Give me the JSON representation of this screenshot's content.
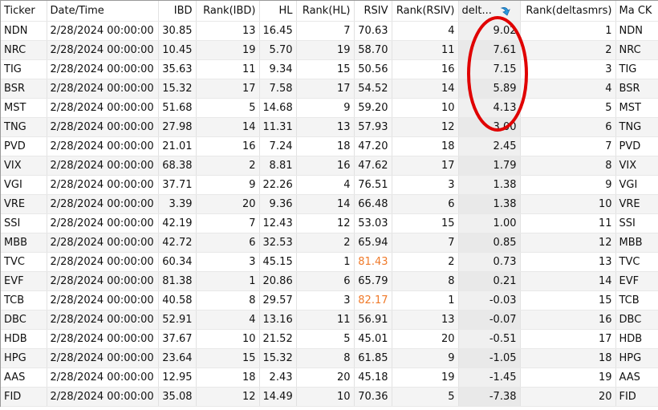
{
  "columns": [
    "Ticker",
    "Date/Time",
    "IBD",
    "Rank(IBD)",
    "HL",
    "Rank(HL)",
    "RSIV",
    "Rank(RSIV)",
    "delt...",
    "Rank(deltasmrs)",
    "Ma CK"
  ],
  "sort": {
    "column": "delt...",
    "direction": "descending",
    "icon": "sort-descending-arrow-icon"
  },
  "highlight_color": "#f07a2a",
  "annotation_color": "#e00000",
  "rows": [
    [
      "NDN",
      "2/28/2024 00:00:00",
      "30.85",
      "13",
      "16.45",
      "7",
      "70.63",
      "4",
      "9.02",
      "1",
      "NDN"
    ],
    [
      "NRC",
      "2/28/2024 00:00:00",
      "10.45",
      "19",
      "5.70",
      "19",
      "58.70",
      "11",
      "7.61",
      "2",
      "NRC"
    ],
    [
      "TIG",
      "2/28/2024 00:00:00",
      "35.63",
      "11",
      "9.34",
      "15",
      "50.56",
      "16",
      "7.15",
      "3",
      "TIG"
    ],
    [
      "BSR",
      "2/28/2024 00:00:00",
      "15.32",
      "17",
      "7.58",
      "17",
      "54.52",
      "14",
      "5.89",
      "4",
      "BSR"
    ],
    [
      "MST",
      "2/28/2024 00:00:00",
      "51.68",
      "5",
      "14.68",
      "9",
      "59.20",
      "10",
      "4.13",
      "5",
      "MST"
    ],
    [
      "TNG",
      "2/28/2024 00:00:00",
      "27.98",
      "14",
      "11.31",
      "13",
      "57.93",
      "12",
      "3.00",
      "6",
      "TNG"
    ],
    [
      "PVD",
      "2/28/2024 00:00:00",
      "21.01",
      "16",
      "7.24",
      "18",
      "47.20",
      "18",
      "2.45",
      "7",
      "PVD"
    ],
    [
      "VIX",
      "2/28/2024 00:00:00",
      "68.38",
      "2",
      "8.81",
      "16",
      "47.62",
      "17",
      "1.79",
      "8",
      "VIX"
    ],
    [
      "VGI",
      "2/28/2024 00:00:00",
      "37.71",
      "9",
      "22.26",
      "4",
      "76.51",
      "3",
      "1.38",
      "9",
      "VGI"
    ],
    [
      "VRE",
      "2/28/2024 00:00:00",
      "3.39",
      "20",
      "9.36",
      "14",
      "66.48",
      "6",
      "1.38",
      "10",
      "VRE"
    ],
    [
      "SSI",
      "2/28/2024 00:00:00",
      "42.19",
      "7",
      "12.43",
      "12",
      "53.03",
      "15",
      "1.00",
      "11",
      "SSI"
    ],
    [
      "MBB",
      "2/28/2024 00:00:00",
      "42.72",
      "6",
      "32.53",
      "2",
      "65.94",
      "7",
      "0.85",
      "12",
      "MBB"
    ],
    [
      "TVC",
      "2/28/2024 00:00:00",
      "60.34",
      "3",
      "45.15",
      "1",
      "81.43",
      "2",
      "0.73",
      "13",
      "TVC"
    ],
    [
      "EVF",
      "2/28/2024 00:00:00",
      "81.38",
      "1",
      "20.86",
      "6",
      "65.79",
      "8",
      "0.21",
      "14",
      "EVF"
    ],
    [
      "TCB",
      "2/28/2024 00:00:00",
      "40.58",
      "8",
      "29.57",
      "3",
      "82.17",
      "1",
      "-0.03",
      "15",
      "TCB"
    ],
    [
      "DBC",
      "2/28/2024 00:00:00",
      "52.91",
      "4",
      "13.16",
      "11",
      "56.91",
      "13",
      "-0.07",
      "16",
      "DBC"
    ],
    [
      "HDB",
      "2/28/2024 00:00:00",
      "37.67",
      "10",
      "21.52",
      "5",
      "45.01",
      "20",
      "-0.51",
      "17",
      "HDB"
    ],
    [
      "HPG",
      "2/28/2024 00:00:00",
      "23.64",
      "15",
      "15.32",
      "8",
      "61.85",
      "9",
      "-1.05",
      "18",
      "HPG"
    ],
    [
      "AAS",
      "2/28/2024 00:00:00",
      "12.95",
      "18",
      "2.43",
      "20",
      "45.18",
      "19",
      "-1.45",
      "19",
      "AAS"
    ],
    [
      "FID",
      "2/28/2024 00:00:00",
      "35.08",
      "12",
      "14.49",
      "10",
      "70.36",
      "5",
      "-7.38",
      "20",
      "FID"
    ]
  ],
  "highlighted_rsiv_rows": [
    "TVC",
    "TCB"
  ]
}
